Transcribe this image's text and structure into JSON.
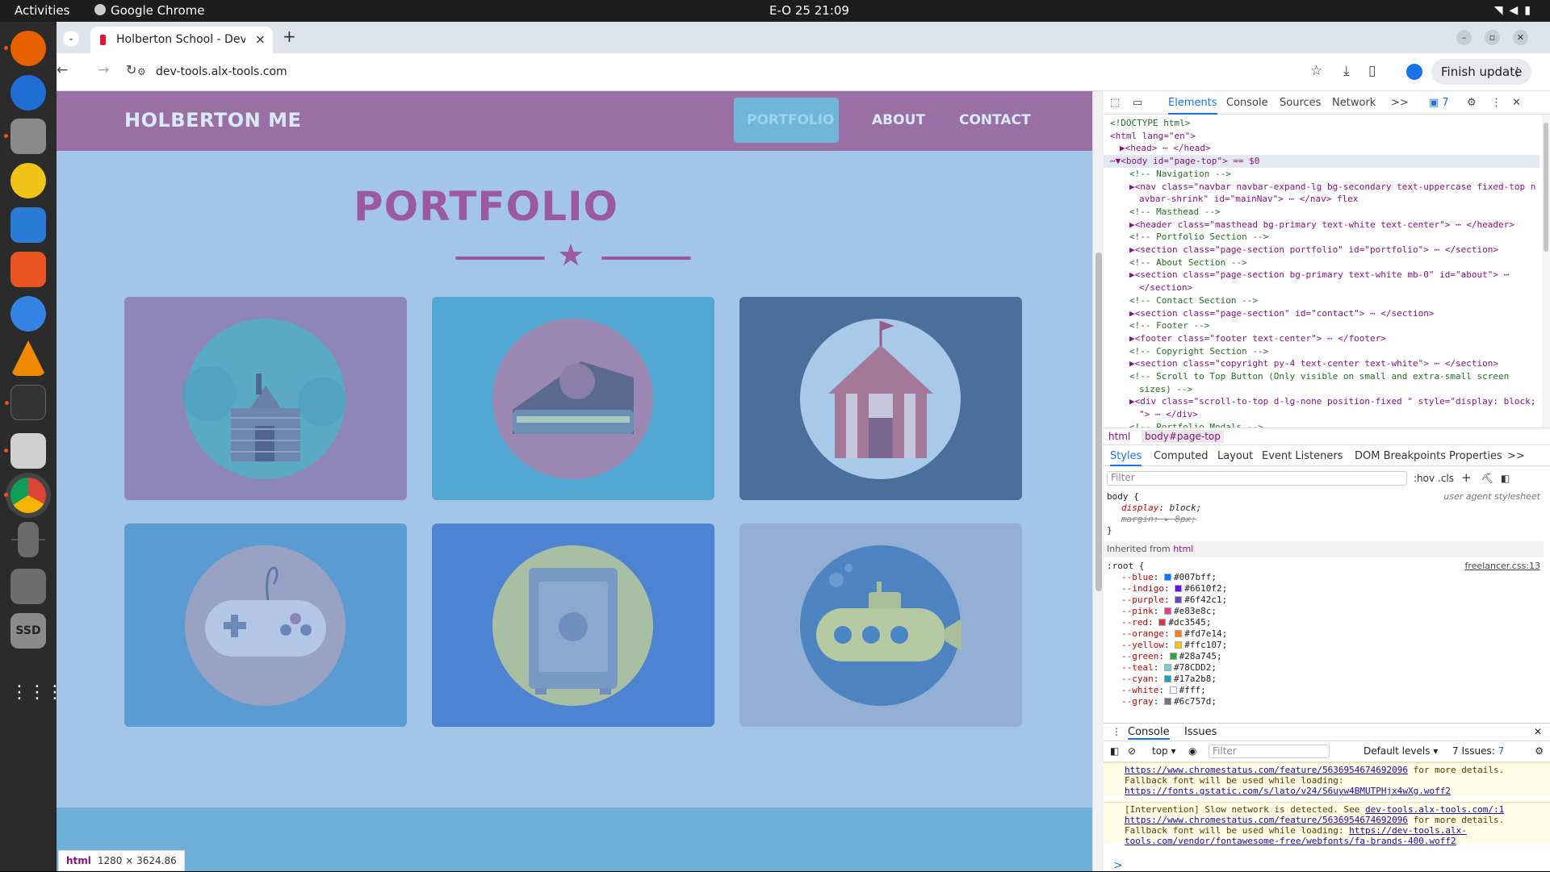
{
  "os": {
    "activities": "Activities",
    "app_name": "Google Chrome",
    "clock": "E-O 25  21:09",
    "tray_icons": [
      "wifi-icon",
      "volume-icon",
      "power-icon"
    ]
  },
  "dock": {
    "items": [
      "firefox",
      "thunderbird",
      "files",
      "rhythmbox",
      "writer",
      "app-center",
      "help",
      "vlc",
      "terminal",
      "magnifier",
      "chrome",
      "phone",
      "drive",
      "ssd",
      "apps-grid"
    ],
    "ssd_label": "SSD"
  },
  "browser": {
    "tab_title": "Holberton School - Deve",
    "url": "dev-tools.alx-tools.com",
    "finish_update": "Finish update",
    "window_buttons": [
      "–",
      "▫",
      "✕"
    ]
  },
  "page": {
    "brand": "HOLBERTON ME",
    "nav": [
      "PORTFOLIO",
      "ABOUT",
      "CONTACT"
    ],
    "section_title": "PORTFOLIO",
    "cards": [
      {
        "name": "cabin",
        "bg": "#8e86b7",
        "disc": "#5aa9c5"
      },
      {
        "name": "cake",
        "bg": "#52a7d3",
        "disc": "#9a88b2"
      },
      {
        "name": "circus",
        "bg": "#4a6f9c",
        "disc": "#a9c9e8"
      },
      {
        "name": "game",
        "bg": "#5a9bd4",
        "disc": "#9aa2c4"
      },
      {
        "name": "safe",
        "bg": "#4d83d0",
        "disc": "#a8bfa4"
      },
      {
        "name": "submarine",
        "bg": "#93afd3",
        "disc": "#4d83c0"
      }
    ],
    "size_tip_tag": "html",
    "size_tip_dims": "1280 × 3624.86"
  },
  "devtools": {
    "tabs": [
      "Elements",
      "Console",
      "Sources",
      "Network",
      ">>"
    ],
    "issues_count": "7",
    "dom": [
      {
        "t": "cm",
        "s": "<!DOCTYPE html>",
        "i": 0
      },
      {
        "t": "raw",
        "s": "<html lang=\"en\">",
        "i": 0
      },
      {
        "t": "raw",
        "s": "▶<head> ⋯ </head>",
        "i": 1
      },
      {
        "t": "sel",
        "s": "⋯▼<body id=\"page-top\"> == $0",
        "i": 0
      },
      {
        "t": "cm",
        "s": "<!-- Navigation -->",
        "i": 2
      },
      {
        "t": "raw",
        "s": "▶<nav class=\"navbar navbar-expand-lg bg-secondary text-uppercase fixed-top n",
        "i": 2
      },
      {
        "t": "raw",
        "s": "avbar-shrink\" id=\"mainNav\"> ⋯ </nav> flex",
        "i": 3
      },
      {
        "t": "cm",
        "s": "<!-- Masthead -->",
        "i": 2
      },
      {
        "t": "raw",
        "s": "▶<header class=\"masthead bg-primary text-white text-center\"> ⋯ </header>",
        "i": 2
      },
      {
        "t": "cm",
        "s": "<!-- Portfolio Section -->",
        "i": 2
      },
      {
        "t": "raw",
        "s": "▶<section class=\"page-section portfolio\" id=\"portfolio\"> ⋯ </section>",
        "i": 2
      },
      {
        "t": "cm",
        "s": "<!-- About Section -->",
        "i": 2
      },
      {
        "t": "raw",
        "s": "▶<section class=\"page-section bg-primary text-white mb-0\" id=\"about\"> ⋯",
        "i": 2
      },
      {
        "t": "raw",
        "s": "</section>",
        "i": 3
      },
      {
        "t": "cm",
        "s": "<!-- Contact Section -->",
        "i": 2
      },
      {
        "t": "raw",
        "s": "▶<section class=\"page-section\" id=\"contact\"> ⋯ </section>",
        "i": 2
      },
      {
        "t": "cm",
        "s": "<!-- Footer -->",
        "i": 2
      },
      {
        "t": "raw",
        "s": "▶<footer class=\"footer text-center\"> ⋯ </footer>",
        "i": 2
      },
      {
        "t": "cm",
        "s": "<!-- Copyright Section -->",
        "i": 2
      },
      {
        "t": "raw",
        "s": "▶<section class=\"copyright py-4 text-center text-white\"> ⋯ </section>",
        "i": 2
      },
      {
        "t": "cm",
        "s": "<!-- Scroll to Top Button (Only visible on small and extra-small screen",
        "i": 2
      },
      {
        "t": "cm",
        "s": "sizes) -->",
        "i": 3
      },
      {
        "t": "raw",
        "s": "▶<div class=\"scroll-to-top d-lg-none position-fixed \" style=\"display: block;",
        "i": 2
      },
      {
        "t": "raw",
        "s": "\"> ⋯ </div>",
        "i": 3
      },
      {
        "t": "cm",
        "s": "<!-- Portfolio Modals -->",
        "i": 2
      }
    ],
    "breadcrumbs": [
      "html",
      "body#page-top"
    ],
    "styles_tabs": [
      "Styles",
      "Computed",
      "Layout",
      "Event Listeners",
      "DOM Breakpoints",
      "Properties",
      ">>"
    ],
    "filter_placeholder": "Filter",
    "style_tools": [
      ":hov",
      ".cls",
      "+"
    ],
    "body_rule": {
      "selector": "body {",
      "source": "user agent stylesheet",
      "props": [
        [
          "display",
          "block;"
        ],
        [
          "margin",
          "▸ 8px;"
        ]
      ]
    },
    "inherited_label": "Inherited from",
    "inherited_tag": "html",
    "root_rule": {
      "selector": ":root {",
      "source": "freelancer.css:13",
      "vars": [
        [
          "--blue",
          "#007bff"
        ],
        [
          "--indigo",
          "#6610f2"
        ],
        [
          "--purple",
          "#6f42c1"
        ],
        [
          "--pink",
          "#e83e8c"
        ],
        [
          "--red",
          "#dc3545"
        ],
        [
          "--orange",
          "#fd7e14"
        ],
        [
          "--yellow",
          "#ffc107"
        ],
        [
          "--green",
          "#28a745"
        ],
        [
          "--teal",
          "#78CDD2"
        ],
        [
          "--cyan",
          "#17a2b8"
        ],
        [
          "--white",
          "#fff"
        ],
        [
          "--gray",
          "#6c757d"
        ]
      ]
    },
    "drawer_tabs": [
      "Console",
      "Issues"
    ],
    "console_context": "top ▾",
    "console_filter": "Filter",
    "default_levels": "Default levels ▾",
    "issues_label": "7 Issues:",
    "messages": [
      {
        "pre": "",
        "link1": "https://www.chromestatus.com/feature/5636954674692096",
        "mid": " for more details. Fallback font will be used while loading: ",
        "link2": "https://fonts.gstatic.com/s/lato/v24/S6uyw4BMUTPHjx4wXg.woff2"
      },
      {
        "pre": "[Intervention] Slow network is detected. See ",
        "link0": "dev-tools.alx-tools.com/:1",
        "link1": "https://www.chromestatus.com/feature/5636954674692096",
        "mid": " for more details. Fallback font will be used while loading: ",
        "link2": "https://dev-tools.alx-tools.com/vendor/fontawesome-free/webfonts/fa-brands-400.woff2"
      }
    ],
    "prompt": ">"
  }
}
